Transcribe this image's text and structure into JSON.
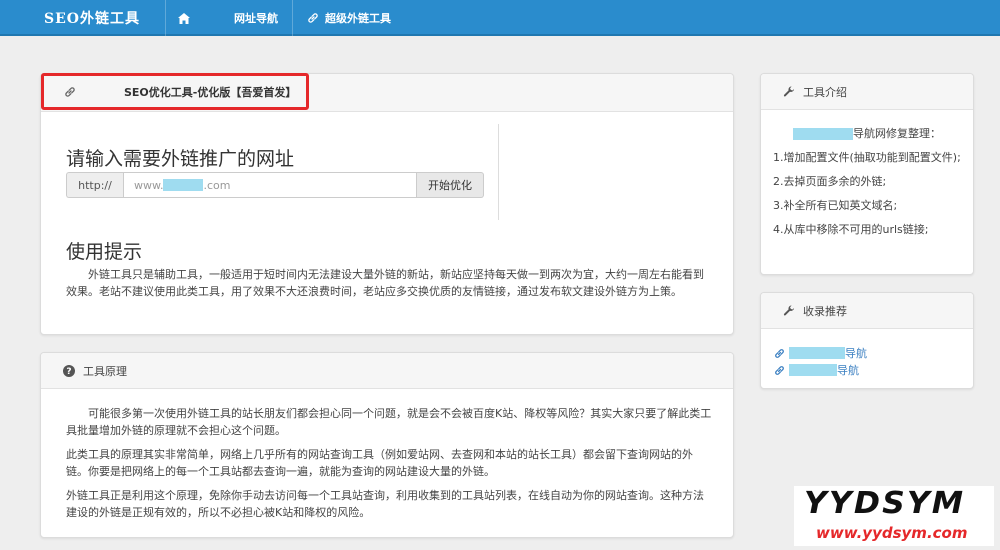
{
  "navbar": {
    "brand": "SEO外链工具",
    "nav_home_label": "网址导航",
    "nav_super_label": "超级外链工具",
    "home_icon": "home-icon",
    "link_icon": "link-icon"
  },
  "main_panel": {
    "header_title": "SEO优化工具-优化版【吾爱首发】",
    "input_heading": "请输入需要外链推广的网址",
    "url_prefix": "http://",
    "url_value_prefix": "www.",
    "url_value_suffix": ".com",
    "submit_label": "开始优化",
    "tips_heading": "使用提示",
    "tips_text": "外链工具只是辅助工具，一般适用于短时间内无法建设大量外链的新站，新站应坚持每天做一到两次为宜，大约一周左右能看到效果。老站不建议使用此类工具，用了效果不大还浪费时间，老站应多交换优质的友情链接，通过发布软文建设外链方为上策。"
  },
  "principle_panel": {
    "header_title": "工具原理",
    "paragraphs": [
      "可能很多第一次使用外链工具的站长朋友们都会担心同一个问题，就是会不会被百度K站、降权等风险？其实大家只要了解此类工具批量增加外链的原理就不会担心这个问题。",
      "此类工具的原理其实非常简单，网络上几乎所有的网站查询工具（例如爱站网、去查网和本站的站长工具）都会留下查询网站的外链。你要是把网络上的每一个工具站都去查询一遍，就能为查询的网站建设大量的外链。",
      "外链工具正是利用这个原理，免除你手动去访问每一个工具站查询，利用收集到的工具站列表，在线自动为你的网站查询。这种方法建设的外链是正规有效的，所以不必担心被K站和降权的风险。"
    ]
  },
  "intro_panel": {
    "header_title": "工具介绍",
    "subtitle": "导航网修复整理：",
    "items": [
      "1.增加配置文件(抽取功能到配置文件);",
      "2.去掉页面多余的外链;",
      "3.补全所有已知英文域名;",
      "4.从库中移除不可用的urls链接;"
    ]
  },
  "recommend_panel": {
    "header_title": "收录推荐",
    "links": [
      "导航",
      "导航"
    ]
  },
  "watermark": {
    "big": "YYDSYM",
    "small": "www.yydsym.com"
  },
  "colors": {
    "navbar": "#2a8ccd",
    "highlight": "#e5282a",
    "link": "#3a7fc1",
    "redaction": "#9fdcf0"
  }
}
